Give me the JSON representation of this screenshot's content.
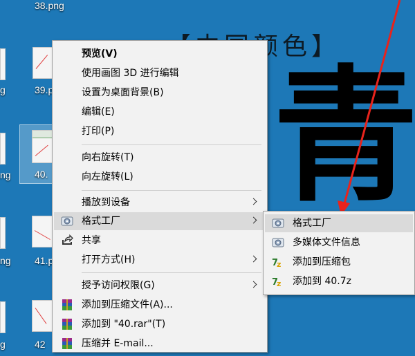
{
  "wallpaper": {
    "title": "【中国颜色】",
    "character": "青"
  },
  "desktop_icons": [
    {
      "label": "38.png"
    },
    {
      "label": "39.p"
    },
    {
      "label": "40."
    },
    {
      "label": "41.p"
    },
    {
      "label": "42"
    },
    {
      "label": "g"
    },
    {
      "label": "ng"
    },
    {
      "label": "ng"
    },
    {
      "label": "g"
    }
  ],
  "context_menu": {
    "items": [
      {
        "label": "预览(V)",
        "bold": true
      },
      {
        "label": "使用画图 3D 进行编辑"
      },
      {
        "label": "设置为桌面背景(B)"
      },
      {
        "label": "编辑(E)"
      },
      {
        "label": "打印(P)"
      },
      {
        "label": "向右旋转(T)"
      },
      {
        "label": "向左旋转(L)"
      },
      {
        "label": "播放到设备",
        "submenu": true
      },
      {
        "label": "格式工厂",
        "submenu": true,
        "icon": "format-factory-icon",
        "highlighted": true
      },
      {
        "label": "共享",
        "icon": "share-icon"
      },
      {
        "label": "打开方式(H)",
        "submenu": true
      },
      {
        "label": "授予访问权限(G)",
        "submenu": true
      },
      {
        "label": "添加到压缩文件(A)...",
        "icon": "winrar-icon"
      },
      {
        "label": "添加到 \"40.rar\"(T)",
        "icon": "winrar-icon"
      },
      {
        "label": "压缩并 E-mail...",
        "icon": "winrar-icon"
      }
    ]
  },
  "submenu": {
    "items": [
      {
        "label": "格式工厂",
        "icon": "format-factory-icon",
        "highlighted": true
      },
      {
        "label": "多媒体文件信息",
        "icon": "format-factory-icon"
      },
      {
        "label": "添加到压缩包",
        "icon": "zip-icon"
      },
      {
        "label": "添加到 40.7z",
        "icon": "zip-icon"
      }
    ]
  },
  "colors": {
    "desktop_bg": "#1d78b7",
    "menu_bg": "#f2f2f2",
    "highlight": "#dadada",
    "annotation_arrow": "#e8231c"
  }
}
